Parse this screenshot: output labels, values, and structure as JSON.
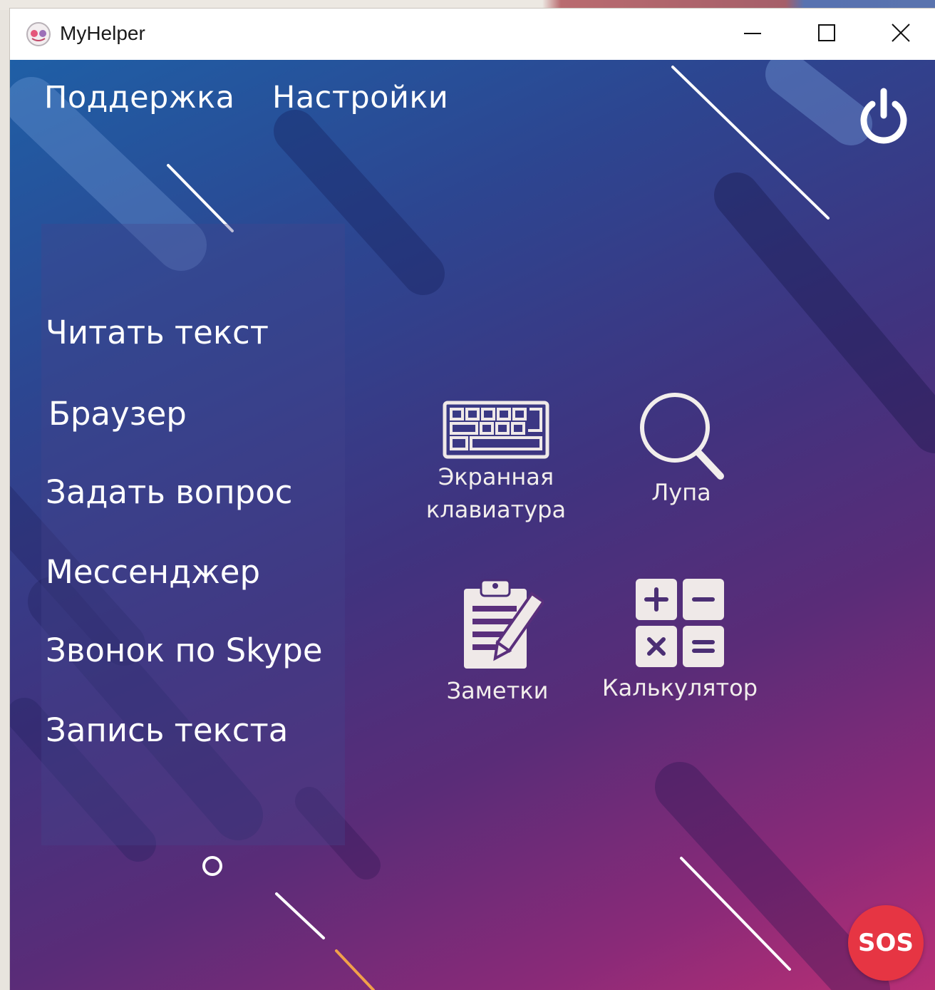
{
  "window": {
    "title": "MyHelper"
  },
  "top_nav": {
    "support": "Поддержка",
    "settings": "Настройки"
  },
  "menu": {
    "items": [
      "Читать текст",
      "Браузер",
      "Задать вопрос",
      "Мессенджер",
      "Звонок по Skype",
      "Запись текста"
    ]
  },
  "tools": {
    "keyboard": {
      "line1": "Экранная",
      "line2": "клавиатура",
      "icon": "keyboard-icon"
    },
    "magnifier": {
      "label": "Лупа",
      "icon": "magnifier-icon"
    },
    "notes": {
      "label": "Заметки",
      "icon": "clipboard-notes-icon"
    },
    "calculator": {
      "label": "Калькулятор",
      "icon": "calculator-icon"
    }
  },
  "sos": {
    "label": "SOS",
    "color": "#e63543"
  },
  "colors": {
    "gradient_top": "#1f5fa6",
    "gradient_mid": "#40337f",
    "gradient_bottom": "#b92f75",
    "text": "#ffffff"
  }
}
